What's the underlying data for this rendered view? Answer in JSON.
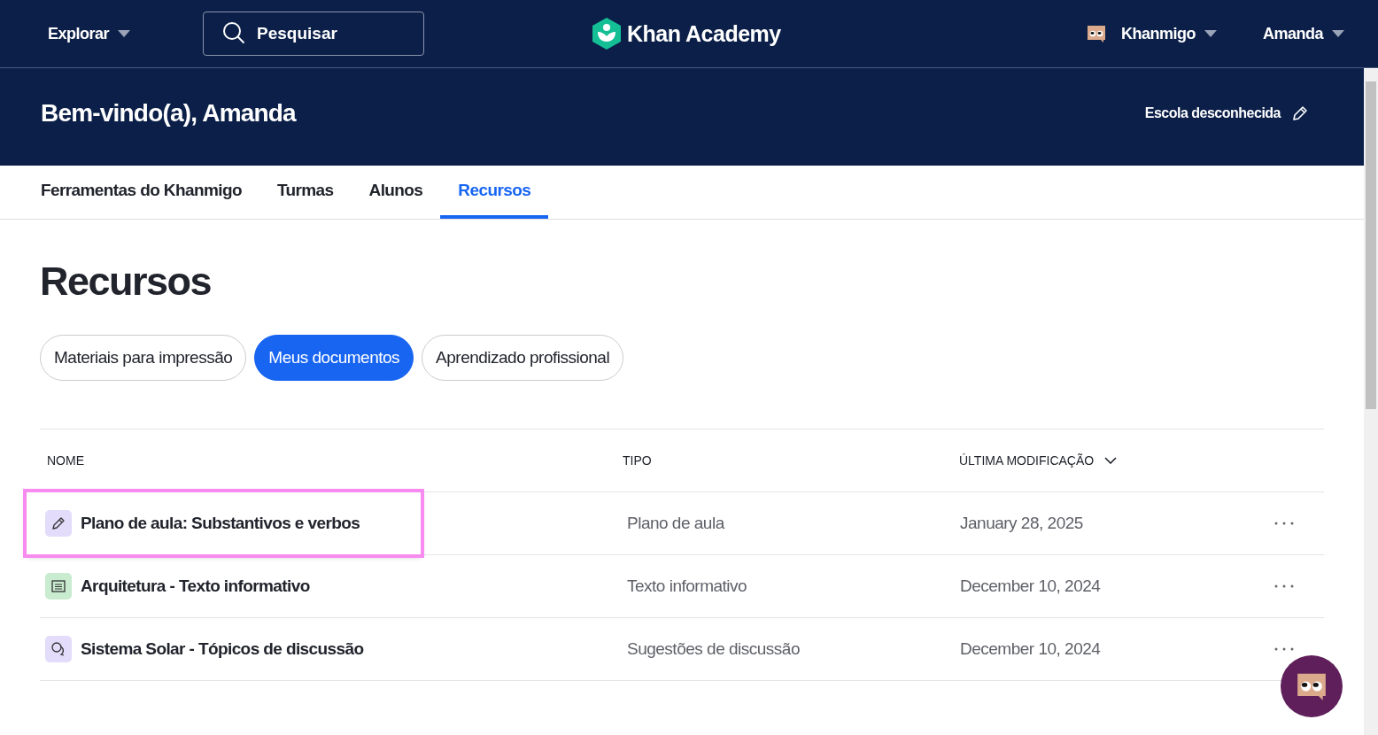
{
  "top_nav": {
    "explore": "Explorar",
    "search": {
      "placeholder": "Pesquisar"
    },
    "logo": "Khan Academy",
    "khanmigo": "Khanmigo",
    "user": "Amanda"
  },
  "header": {
    "title": "Bem-vindo(a), Amanda",
    "school": "Escola desconhecida"
  },
  "tabs": [
    {
      "label": "Ferramentas do Khanmigo",
      "selected": false
    },
    {
      "label": "Turmas",
      "selected": false
    },
    {
      "label": "Alunos",
      "selected": false
    },
    {
      "label": "Recursos",
      "selected": true
    }
  ],
  "page_title": "Recursos",
  "filters": [
    {
      "label": "Materiais para impressão",
      "selected": false
    },
    {
      "label": "Meus documentos",
      "selected": true
    },
    {
      "label": "Aprendizado profissional",
      "selected": false
    }
  ],
  "table": {
    "columns": [
      "NOME",
      "TIPO",
      "ÚLTIMA MODIFICAÇÃO"
    ],
    "rows": [
      {
        "kind": "lesson-plan",
        "name": "Plano de aula: Substantivos e verbos",
        "type": "Plano de aula",
        "modified": "January 28, 2025",
        "highlighted": true
      },
      {
        "kind": "text",
        "name": "Arquitetura - Texto informativo",
        "type": "Texto informativo",
        "modified": "December 10, 2024",
        "highlighted": false
      },
      {
        "kind": "discussion",
        "name": "Sistema Solar - Tópicos de discussão",
        "type": "Sugestões de discussão",
        "modified": "December 10, 2024",
        "highlighted": false
      }
    ]
  }
}
